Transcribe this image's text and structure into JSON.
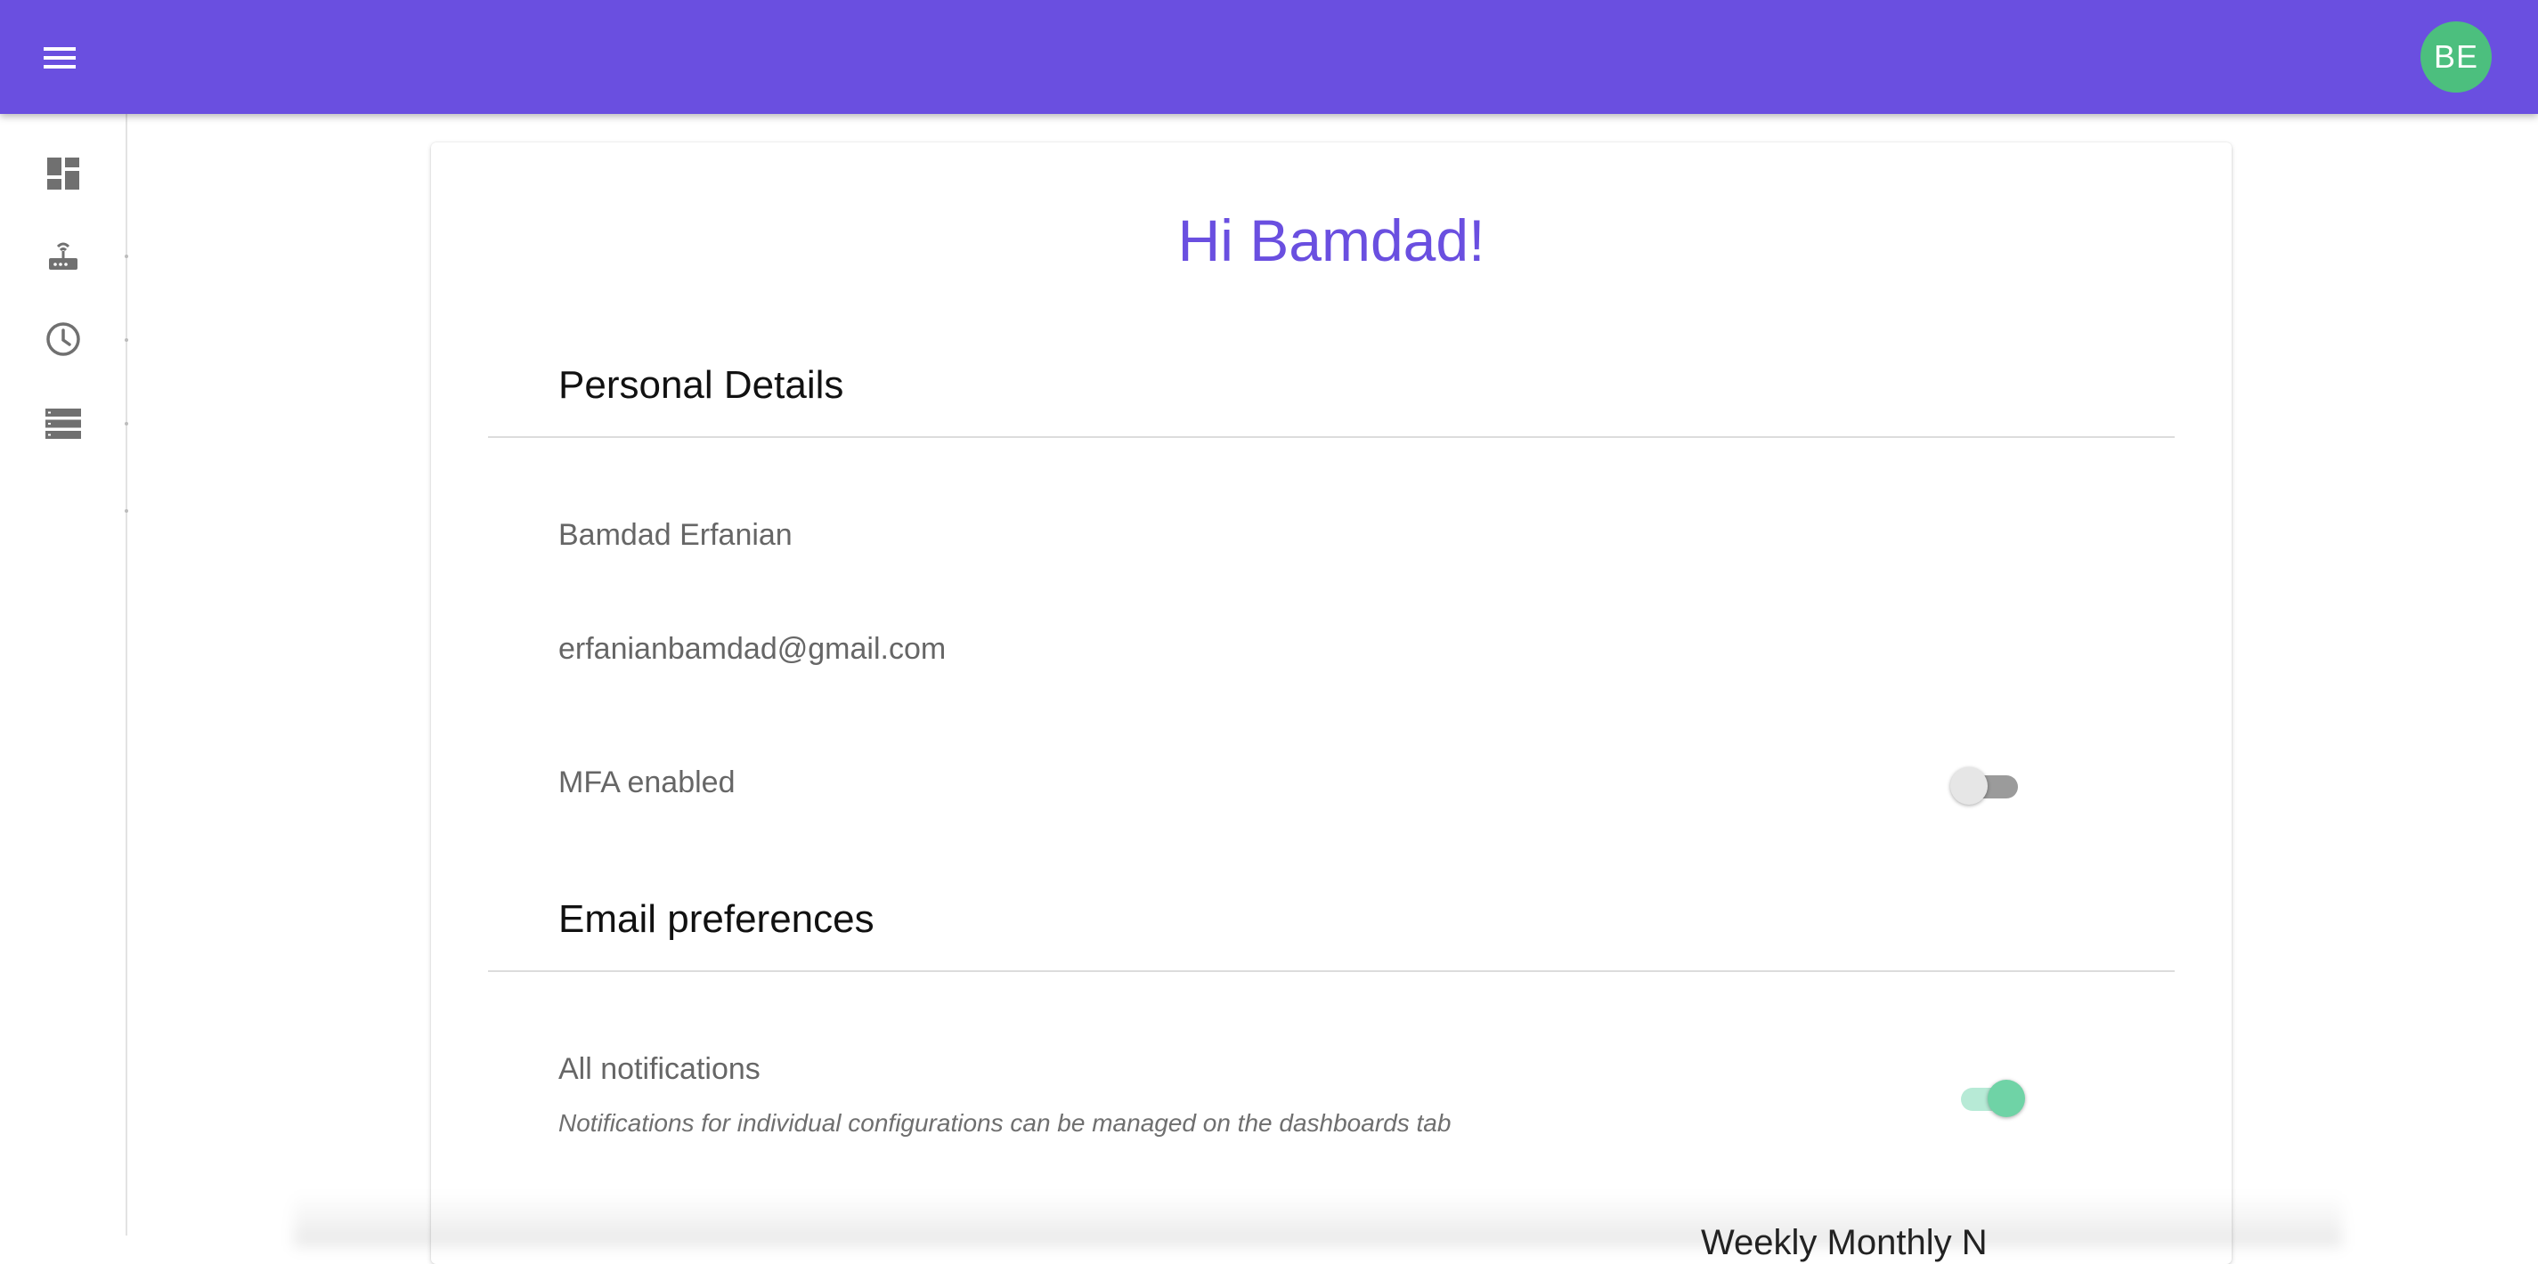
{
  "header": {
    "menu_icon": "hamburger-menu-icon",
    "avatar_initials": "BE",
    "colors": {
      "bar": "#6a4fe0",
      "avatar": "#4cbf7e"
    }
  },
  "sidebar": {
    "items": [
      {
        "icon": "dashboard-icon"
      },
      {
        "icon": "router-icon"
      },
      {
        "icon": "clock-icon"
      },
      {
        "icon": "storage-list-icon"
      }
    ]
  },
  "profile": {
    "greeting": "Hi Bamdad!",
    "personal_details": {
      "title": "Personal Details",
      "name": "Bamdad Erfanian",
      "email": "erfanianbamdad@gmail.com",
      "mfa_label": "MFA enabled",
      "mfa_enabled": false
    },
    "email_preferences": {
      "title": "Email preferences",
      "all_notifications_label": "All notifications",
      "all_notifications_hint": "Notifications for individual configurations can be managed on the dashboards tab",
      "all_notifications_enabled": true
    },
    "cutoff_text": "Weekly      Monthly      N"
  }
}
